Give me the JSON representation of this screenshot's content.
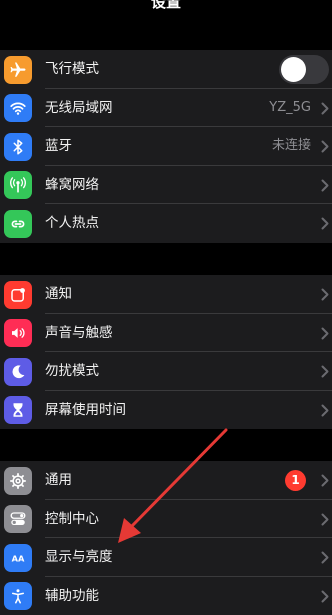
{
  "header": {
    "title": "设置"
  },
  "groups": [
    {
      "rows": [
        {
          "label": "飞行模式",
          "icon": "airplane-icon",
          "color": "#f79b2e",
          "toggle": false
        },
        {
          "label": "无线局域网",
          "icon": "wifi-icon",
          "color": "#2f7cf6",
          "value": "YZ_5G"
        },
        {
          "label": "蓝牙",
          "icon": "bluetooth-icon",
          "color": "#2f7cf6",
          "value": "未连接"
        },
        {
          "label": "蜂窝网络",
          "icon": "cellular-icon",
          "color": "#34c759"
        },
        {
          "label": "个人热点",
          "icon": "hotspot-icon",
          "color": "#34c759"
        }
      ]
    },
    {
      "rows": [
        {
          "label": "通知",
          "icon": "notifications-icon",
          "color": "#ff3b30"
        },
        {
          "label": "声音与触感",
          "icon": "sound-icon",
          "color": "#ff2d55"
        },
        {
          "label": "勿扰模式",
          "icon": "moon-icon",
          "color": "#5e5ce6"
        },
        {
          "label": "屏幕使用时间",
          "icon": "hourglass-icon",
          "color": "#5e5ce6"
        }
      ]
    },
    {
      "rows": [
        {
          "label": "通用",
          "icon": "gear-icon",
          "color": "#8e8e93",
          "badge": "1"
        },
        {
          "label": "控制中心",
          "icon": "toggles-icon",
          "color": "#8e8e93"
        },
        {
          "label": "显示与亮度",
          "icon": "display-icon",
          "color": "#2f7cf6"
        },
        {
          "label": "辅助功能",
          "icon": "accessibility-icon",
          "color": "#2f7cf6"
        }
      ]
    }
  ],
  "annotation": {
    "arrow_color": "#e53935"
  }
}
